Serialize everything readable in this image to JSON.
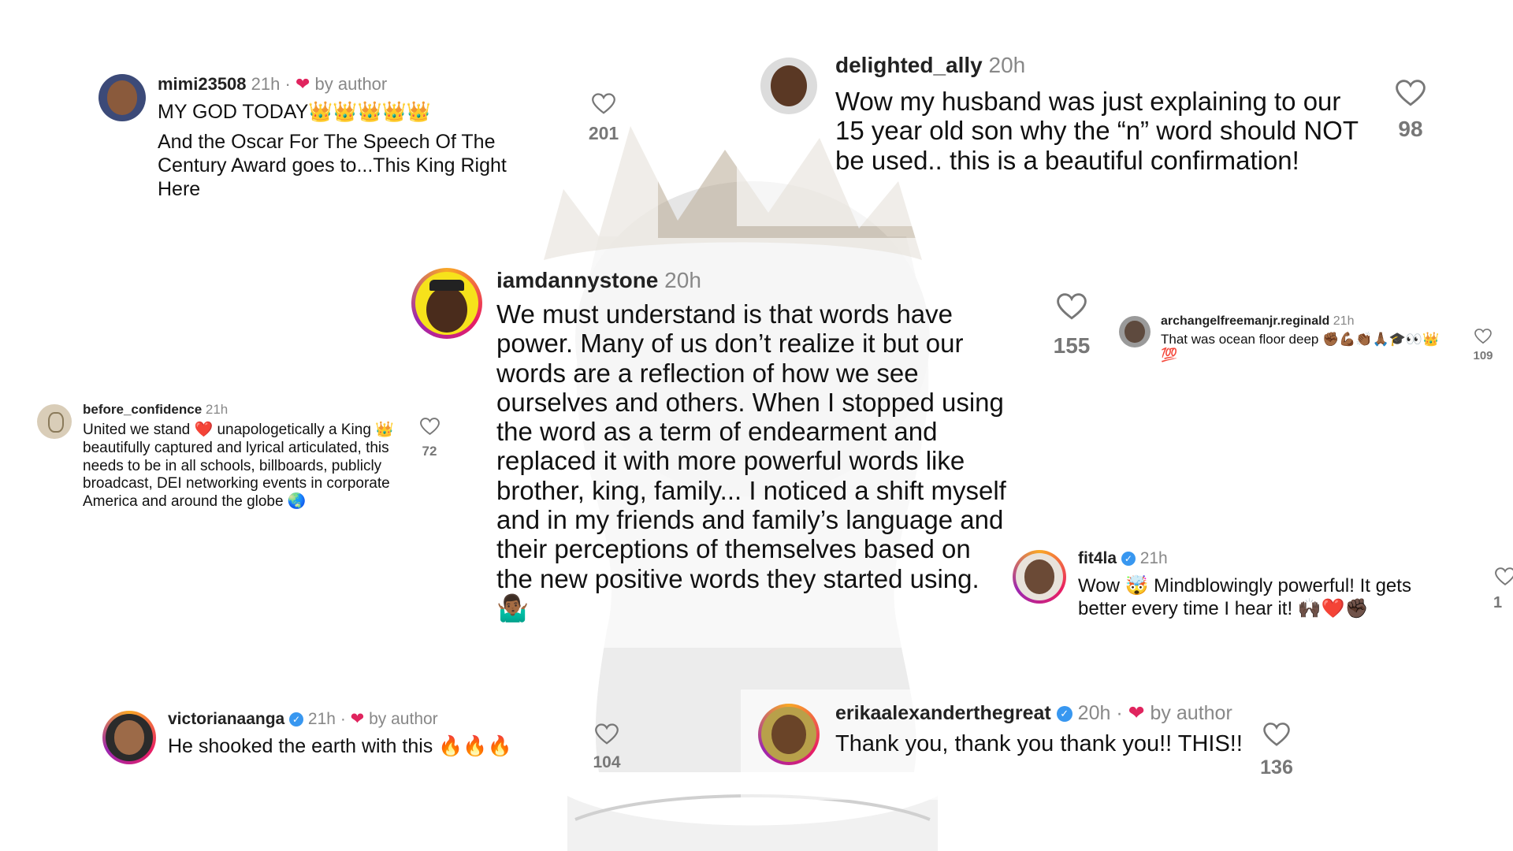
{
  "comments": [
    {
      "username": "mimi23508",
      "time": "21h",
      "by_author": "by author",
      "text_line1": "MY GOD TODAY👑👑👑👑👑",
      "text_rest": "And the Oscar For The Speech Of The Century Award goes to...This King Right Here",
      "likes": "201"
    },
    {
      "username": "delighted_ally",
      "time": "20h",
      "text": "Wow my husband was just explaining to our 15 year old son why the “n” word should NOT be used.. this is a beautiful confirmation!",
      "likes": "98"
    },
    {
      "username": "iamdannystone",
      "time": "20h",
      "text": "We must understand is that words have power. Many of us don’t realize it but our words are a reflection of how we see ourselves and others. When I stopped using the word as a term of endearment and replaced it with more powerful words like brother, king, family... I noticed a shift myself and in my friends and family’s language and their perceptions of themselves based on the new positive words they started using. 🤷🏾‍♂️",
      "likes": "155"
    },
    {
      "username": "archangelfreemanjr.reginald",
      "time": "21h",
      "text": "That was ocean floor deep ✊🏾💪🏾👏🏾🙏🏾🎓👀👑💯",
      "likes": "109"
    },
    {
      "username": "before_confidence",
      "time": "21h",
      "text": "United we stand ❤️ unapologetically a King 👑 beautifully captured and lyrical articulated, this needs to be in all schools, billboards, publicly broadcast, DEI networking events in corporate America and around the globe 🌏",
      "likes": "72"
    },
    {
      "username": "fit4la",
      "time": "21h",
      "text": "Wow 🤯 Mindblowingly powerful! It gets better every time I hear it! 🙌🏿❤️✊🏿",
      "likes": "1"
    },
    {
      "username": "victorianaanga",
      "time": "21h",
      "by_author": "by author",
      "text": "He shooked the earth with this 🔥🔥🔥",
      "likes": "104"
    },
    {
      "username": "erikaalexanderthegreat",
      "time": "20h",
      "by_author": "by author",
      "text": "Thank you, thank you thank you!! THIS!!",
      "likes": "136"
    }
  ],
  "icons": {
    "like": "heart-outline-icon",
    "author_like": "heart-filled-icon",
    "verified": "verified-badge-icon"
  },
  "colors": {
    "author_heart": "#e0245e",
    "verified": "#3897f0",
    "muted_text": "#888888"
  }
}
